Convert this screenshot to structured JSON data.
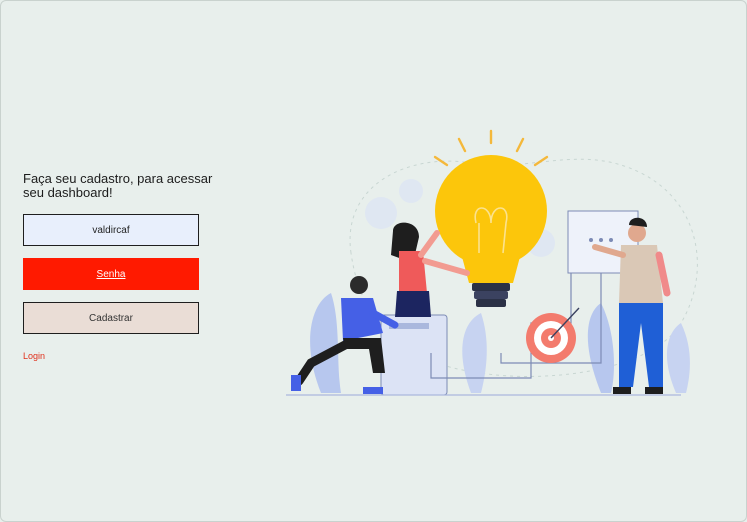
{
  "heading": "Faça seu cadastro, para acessar seu dashboard!",
  "form": {
    "username_value": "valdircaf",
    "password_placeholder": "Senha",
    "submit_label": "Cadastrar",
    "login_link": "Login"
  },
  "colors": {
    "background": "#e8efec",
    "password_field": "#ff1a00",
    "submit_button": "#eaddd6",
    "link": "#e0301c"
  },
  "illustration": {
    "icon": "lightbulb-teamwork-illustration"
  }
}
